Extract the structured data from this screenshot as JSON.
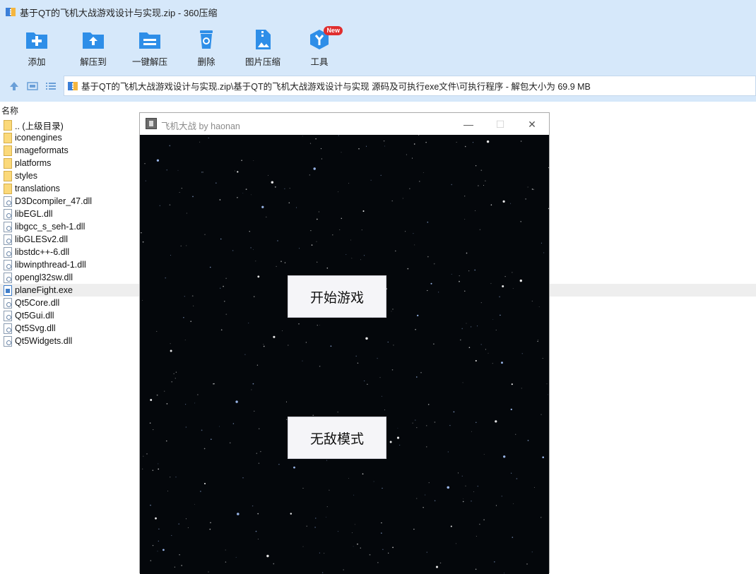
{
  "window": {
    "title": "基于QT的飞机大战游戏设计与实现.zip - 360压缩"
  },
  "toolbar": {
    "items": [
      {
        "label": "添加",
        "icon": "add-folder-icon"
      },
      {
        "label": "解压到",
        "icon": "extract-to-icon"
      },
      {
        "label": "一键解压",
        "icon": "one-click-extract-icon"
      },
      {
        "label": "删除",
        "icon": "trash-icon"
      },
      {
        "label": "图片压缩",
        "icon": "image-compress-icon"
      },
      {
        "label": "工具",
        "icon": "tools-icon",
        "badge": "New"
      }
    ],
    "accent": "#2e8ee8"
  },
  "address": {
    "path": "基于QT的飞机大战游戏设计与实现.zip\\基于QT的飞机大战游戏设计与实现 源码及可执行exe文件\\可执行程序 - 解包大小为 69.9 MB"
  },
  "list": {
    "header": "名称",
    "files": [
      {
        "name": ".. (上级目录)",
        "type": "folder"
      },
      {
        "name": "iconengines",
        "type": "folder"
      },
      {
        "name": "imageformats",
        "type": "folder"
      },
      {
        "name": "platforms",
        "type": "folder"
      },
      {
        "name": "styles",
        "type": "folder"
      },
      {
        "name": "translations",
        "type": "folder"
      },
      {
        "name": "D3Dcompiler_47.dll",
        "type": "dll"
      },
      {
        "name": "libEGL.dll",
        "type": "dll"
      },
      {
        "name": "libgcc_s_seh-1.dll",
        "type": "dll"
      },
      {
        "name": "libGLESv2.dll",
        "type": "dll"
      },
      {
        "name": "libstdc++-6.dll",
        "type": "dll"
      },
      {
        "name": "libwinpthread-1.dll",
        "type": "dll"
      },
      {
        "name": "opengl32sw.dll",
        "type": "dll"
      },
      {
        "name": "planeFight.exe",
        "type": "exe",
        "selected": true
      },
      {
        "name": "Qt5Core.dll",
        "type": "dll"
      },
      {
        "name": "Qt5Gui.dll",
        "type": "dll"
      },
      {
        "name": "Qt5Svg.dll",
        "type": "dll"
      },
      {
        "name": "Qt5Widgets.dll",
        "type": "dll"
      }
    ]
  },
  "game": {
    "title": "飞机大战 by haonan",
    "start_label": "开始游戏",
    "invincible_label": "无敌模式",
    "controls": {
      "min": "—",
      "max": "☐",
      "close": "✕"
    }
  }
}
